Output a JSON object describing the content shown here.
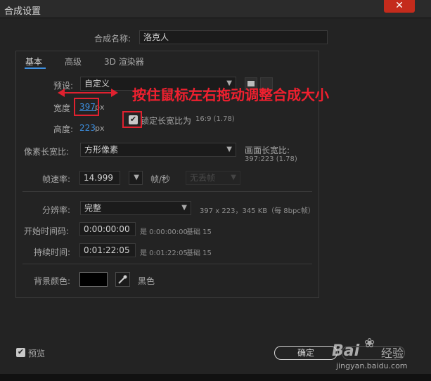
{
  "window": {
    "title": "合成设置",
    "close_glyph": "✕"
  },
  "comp_name": {
    "label": "合成名称:",
    "value": "洛克人"
  },
  "tabs": [
    {
      "label": "基本",
      "active": true
    },
    {
      "label": "高级"
    },
    {
      "label": "3D 渲染器"
    }
  ],
  "preset": {
    "label": "预设:",
    "value": "自定义"
  },
  "width": {
    "label": "宽度",
    "value": "397",
    "unit": "px"
  },
  "height": {
    "label": "高度:",
    "value": "223",
    "unit": "px"
  },
  "lock_aspect": {
    "label": "锁定长宽比为",
    "ratio": "16:9 (1.78)",
    "checked": true
  },
  "pixel_aspect": {
    "label": "像素长宽比:",
    "value": "方形像素"
  },
  "frame_aspect": {
    "label": "画面长宽比:",
    "value": "397:223 (1.78)"
  },
  "frame_rate": {
    "label": "帧速率:",
    "value": "14.999",
    "unit": "帧/秒",
    "drop_frame": "无丢帧"
  },
  "resolution": {
    "label": "分辨率:",
    "value": "完整",
    "info": "397 x 223，345 KB（每 8bpc帧）"
  },
  "start_timecode": {
    "label": "开始时间码:",
    "value": "0:00:00:00",
    "equals": "是 0:00:00:00",
    "base": "基础 15"
  },
  "duration": {
    "label": "持续时间:",
    "value": "0:01:22:05",
    "equals": "是 0:01:22:05",
    "base": "基础 15"
  },
  "bg_color": {
    "label": "背景颜色:",
    "name": "黑色",
    "hex": "#000000"
  },
  "preview": {
    "label": "预览",
    "checked": true
  },
  "ok_button": {
    "label": "确定"
  },
  "annotation": {
    "text": "按住鼠标左右拖动调整合成大小",
    "color": "#f0202f"
  },
  "watermark": {
    "brand": "Bai",
    "suffix": "经验",
    "url": "jingyan.baidu.com"
  },
  "colors": {
    "accent": "#3d8fe0",
    "background": "#232323",
    "annotation_red": "#e0212f"
  }
}
